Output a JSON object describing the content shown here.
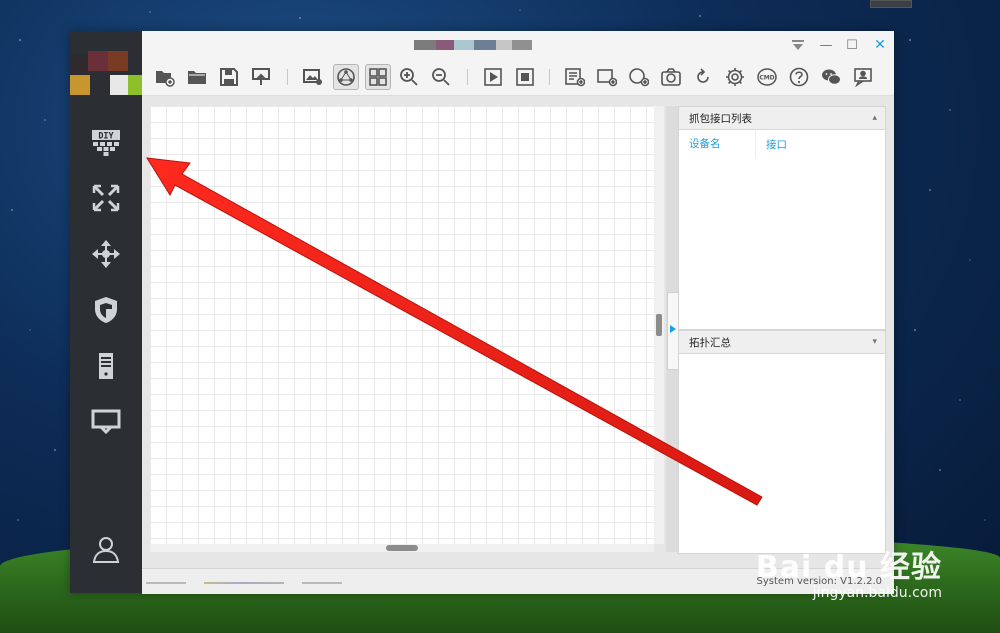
{
  "desktop": {
    "watermark": {
      "brand": "Bai du 经验",
      "url": "jingyan.baidu.com"
    }
  },
  "window": {
    "title_obscured": true,
    "controls": {
      "menu_icon": "menu-icon",
      "minimize": "—",
      "maximize": "☐",
      "close": "✕"
    }
  },
  "sidebar": {
    "logo_colors": [
      "#2f2a2e",
      "#6b2f3a",
      "#7a3b24",
      "#c8962e",
      "#2b2e33",
      "#e8e8e8",
      "#8cbf2a"
    ],
    "items": [
      {
        "name": "diy",
        "icon": "diy-icon",
        "label": "DIY"
      },
      {
        "name": "topology",
        "icon": "topology-icon"
      },
      {
        "name": "network",
        "icon": "move-icon"
      },
      {
        "name": "security",
        "icon": "shield-icon"
      },
      {
        "name": "server",
        "icon": "server-icon"
      },
      {
        "name": "monitor",
        "icon": "monitor-icon"
      },
      {
        "name": "user",
        "icon": "user-icon"
      }
    ]
  },
  "toolbar": {
    "buttons": [
      "new-folder-icon",
      "open-folder-icon",
      "save-icon",
      "export-icon",
      "screenshot-icon",
      "auto-layout-icon",
      "grid-view-icon",
      "zoom-in-icon",
      "zoom-out-icon",
      "play-icon",
      "stop-icon",
      "list-icon",
      "add-rect-icon",
      "add-circle-icon",
      "camera-icon",
      "refresh-icon",
      "settings-icon",
      "cmd-icon",
      "help-icon",
      "wechat-icon",
      "feedback-icon"
    ],
    "cmd_label": "CMD"
  },
  "right_panel": {
    "capture": {
      "title": "抓包接口列表",
      "columns": [
        "设备名",
        "接口"
      ]
    },
    "topology": {
      "title": "拓扑汇总"
    }
  },
  "status": {
    "version_text": "System version: V1.2.2.0"
  },
  "colors": {
    "accent": "#1a9fe0",
    "sidebar": "#2b2e33",
    "arrow": "#e8221b"
  }
}
